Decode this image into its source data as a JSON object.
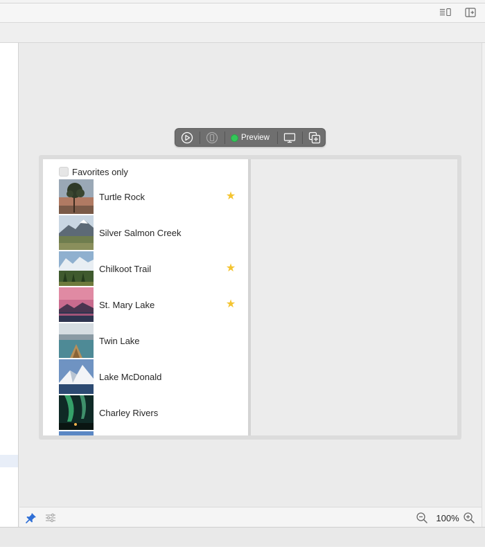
{
  "canvas": {
    "preview_bar": {
      "preview_label": "Preview",
      "status_color": "#34c759"
    }
  },
  "app_preview": {
    "favorites_toggle_label": "Favorites only",
    "favorites_checked": false,
    "landmarks": [
      {
        "name": "Turtle Rock",
        "favorite": true,
        "thumb": "desert-tree"
      },
      {
        "name": "Silver Salmon Creek",
        "favorite": false,
        "thumb": "snowy-mountain-meadow"
      },
      {
        "name": "Chilkoot Trail",
        "favorite": true,
        "thumb": "mountain-forest"
      },
      {
        "name": "St. Mary Lake",
        "favorite": true,
        "thumb": "pink-sunset-lake"
      },
      {
        "name": "Twin Lake",
        "favorite": false,
        "thumb": "lake-canoe"
      },
      {
        "name": "Lake McDonald",
        "favorite": false,
        "thumb": "snow-peak-lake"
      },
      {
        "name": "Charley Rivers",
        "favorite": false,
        "thumb": "aurora-night"
      }
    ],
    "star_color": "#f4c430"
  },
  "footer": {
    "zoom_level": "100%"
  },
  "accent_color": "#2f6fd6"
}
